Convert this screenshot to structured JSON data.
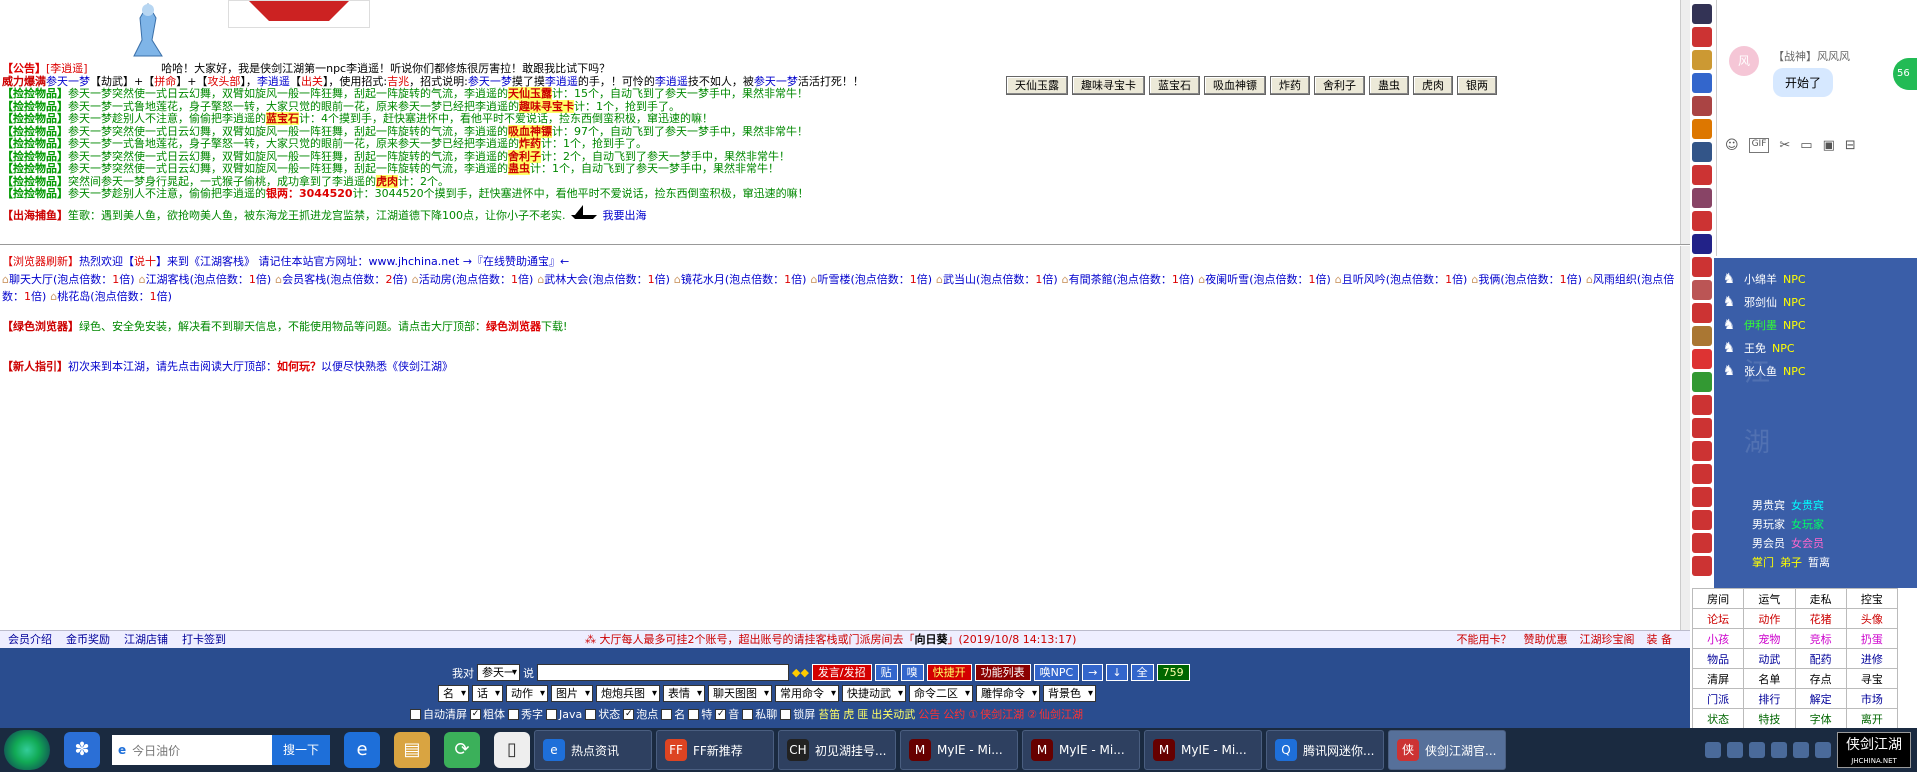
{
  "chat": {
    "announcement": {
      "tag": "【公告】",
      "npc_name": "[李逍遥]",
      "text": "哈哈！大家好，我是侠剑江湖第一npc李逍遥！听说你们都修炼很厉害拉！敢跟我比试下吗？"
    },
    "fight_line": {
      "tag": "威力爆满",
      "player": "参天一梦",
      "part1": "【劫武】+【",
      "weapon": "拼命",
      "part2": "】+【",
      "armor": "攻头部",
      "part3": "】，",
      "target": "李逍遥",
      "bracket_open": "【",
      "skill_tag": "出关",
      "bracket_close": "】，使用招式:",
      "skill": "吉兆",
      "desc_pre": "，招式说明:",
      "player2": "参天一梦",
      "desc_mid": "摸了摸",
      "target2": "李逍遥",
      "desc_mid2": "的手，！可怜的",
      "target3": "李逍遥",
      "desc_mid3": "技不如人，被",
      "player3": "参天一梦",
      "desc_end": "活活打死！！"
    },
    "pickup_lines": [
      {
        "tag": "【捡捡物品】",
        "pre": "参天一梦突然使一式日云幻舞，双臂如旋风一般一阵狂舞，刮起一阵旋转的气流，李逍遥的",
        "item": "天仙玉露",
        "post": "计：15个，自动飞到了参天一梦手中，果然非常牛！"
      },
      {
        "tag": "【捡捡物品】",
        "pre": "参天一梦一式鲁地莲花，身子擎怒一转，大家只觉的眼前一花，原来参天一梦已经把李逍遥的",
        "item": "趣味寻宝卡",
        "post": "计：1个，抢到手了。"
      },
      {
        "tag": "【捡捡物品】",
        "pre": "参天一梦趁别人不注意，偷偷把李逍遥的",
        "item": "蓝宝石",
        "post": "计：4个摸到手，赶快塞进怀中，看他平时不爱说话，捡东西倒蛮积极，窜迅速的嘛！"
      },
      {
        "tag": "【捡捡物品】",
        "pre": "参天一梦突然使一式日云幻舞，双臂如旋风一般一阵狂舞，刮起一阵旋转的气流，李逍遥的",
        "item": "吸血神镖",
        "post": "计：97个，自动飞到了参天一梦手中，果然非常牛！"
      },
      {
        "tag": "【捡捡物品】",
        "pre": "参天一梦一式鲁地莲花，身子擎怒一转，大家只觉的眼前一花，原来参天一梦已经把李逍遥的",
        "item": "炸药",
        "post": "计：1个，抢到手了。"
      },
      {
        "tag": "【捡捡物品】",
        "pre": "参天一梦突然使一式日云幻舞，双臂如旋风一般一阵狂舞，刮起一阵旋转的气流，李逍遥的",
        "item": "舍利子",
        "post": "计：2个，自动飞到了参天一梦手中，果然非常牛！"
      },
      {
        "tag": "【捡捡物品】",
        "pre": "参天一梦突然使一式日云幻舞，双臂如旋风一般一阵狂舞，刮起一阵旋转的气流，李逍遥的",
        "item": "蛊虫",
        "post": "计：1个，自动飞到了参天一梦手中，果然非常牛！"
      },
      {
        "tag": "【捡捡物品】",
        "pre": "突然间参天一梦身行晁起，一式猴子偷桃，成功拿到了李逍遥的",
        "item": "虎肉",
        "post": "计：2个。"
      },
      {
        "tag": "【捡捡物品】",
        "pre": "参天一梦趁别人不注意，偷偷把李逍遥的",
        "item": "银两：3044520",
        "post": "计：3044520个摸到手，赶快塞进怀中，看他平时不爱说话，捡东西倒蛮积极，窜迅速的嘛！"
      }
    ],
    "sea_line": {
      "tag": "【出海捕鱼】",
      "text": "笙歌：遇到美人鱼，欲抢吻美人鱼，被东海龙王抓进龙宫监禁，江湖道德下降100点，让你小子不老实.",
      "link": "我要出海"
    },
    "item_buttons": [
      "天仙玉露",
      "趣味寻宝卡",
      "蓝宝石",
      "吸血神镖",
      "炸药",
      "舍利子",
      "蛊虫",
      "虎肉",
      "银两"
    ]
  },
  "lobby": {
    "refresh_line": {
      "tag": "【浏览器刷新】",
      "pre": "热烈欢迎【",
      "name": "说十",
      "mid": "】来到《江湖客栈》 请记住本站官方网址：www.jhchina.net →『在线赞助通宝』←"
    },
    "rooms": [
      {
        "name": "聊天大厅",
        "info": "(泡点倍数：",
        "mult": "1",
        "end": "倍)"
      },
      {
        "name": "江湖客栈",
        "info": "(泡点倍数：",
        "mult": "1",
        "end": "倍)"
      },
      {
        "name": "会员客栈",
        "info": "(泡点倍数：",
        "mult": "2",
        "end": "倍)"
      },
      {
        "name": "活动房",
        "info": "(泡点倍数：",
        "mult": "1",
        "end": "倍)"
      },
      {
        "name": "武林大会",
        "info": "(泡点倍数：",
        "mult": "1",
        "end": "倍)"
      },
      {
        "name": "镜花水月",
        "info": "(泡点倍数：",
        "mult": "1",
        "end": "倍)"
      },
      {
        "name": "听雪楼",
        "info": "(泡点倍数：",
        "mult": "1",
        "end": "倍)"
      },
      {
        "name": "武当山",
        "info": "(泡点倍数：",
        "mult": "1",
        "end": "倍)"
      },
      {
        "name": "有間茶館",
        "info": "(泡点倍数：",
        "mult": "1",
        "end": "倍)"
      },
      {
        "name": "夜阑听雪",
        "info": "(泡点倍数：",
        "mult": "1",
        "end": "倍)"
      }
    ],
    "rooms_row2": [
      {
        "name": "且听风吟",
        "info": "(泡点倍数：",
        "mult": "1",
        "end": "倍)"
      },
      {
        "name": "我俩",
        "info": "(泡点倍数：",
        "mult": "1",
        "end": "倍)"
      },
      {
        "name": "风雨组织",
        "info": "(泡点倍数：",
        "mult": "1",
        "end": "倍)"
      },
      {
        "name": "桃花岛",
        "info": "(泡点倍数：",
        "mult": "1",
        "end": "倍)"
      }
    ],
    "green_browser": {
      "tag": "【绿色浏览器】",
      "text": "绿色、安全免安装，解决看不到聊天信息，不能使用物品等问题。请点击大厅顶部：",
      "link": "绿色浏览器",
      "end": "下载!"
    },
    "newbie": {
      "tag": "【新人指引】",
      "text": "初次来到本江湖，请先点击阅读大厅顶部：",
      "link": "如何玩？",
      "end": "以便尽快熟悉《侠剑江湖》"
    }
  },
  "status_bar": {
    "left_links": [
      "会员介绍",
      "金币奖励",
      "江湖店铺",
      "打卡签到"
    ],
    "notice_pre": "⁂ 大厅每人最多可挂2个账号，超出账号的请挂客栈或门派房间去「",
    "notice_room": "向日葵",
    "notice_post": "」(2019/10/8 14:13:17)",
    "right_links": [
      "不能用卡？",
      "赞助优惠",
      "江湖珍宝阁",
      "装 备"
    ]
  },
  "controls": {
    "say_prefix": "我对",
    "say_target": "参天一",
    "say_suffix": "说",
    "send_button": "发言/发招",
    "paste_button": "贴",
    "clear_button": "嗅",
    "quick_open": "快捷开",
    "function_list": "功能列表",
    "wake_npc": "唤NPC",
    "arrow_right": "→",
    "arrow_down": "↓",
    "all": "全",
    "counter": "759",
    "selects": [
      "名",
      "话",
      "动作",
      "图片",
      "炮炮兵图",
      "表情",
      "聊天图图",
      "常用命令",
      "快捷动武",
      "命令二区",
      "雕悍命令",
      "背景色"
    ],
    "checkboxes": [
      {
        "label": "自动清屏",
        "checked": false
      },
      {
        "label": "粗体",
        "checked": true
      },
      {
        "label": "秀字",
        "checked": false
      },
      {
        "label": "Java",
        "checked": false
      },
      {
        "label": "状态",
        "checked": false
      },
      {
        "label": "泡点",
        "checked": true
      },
      {
        "label": "名",
        "checked": false
      },
      {
        "label": "特",
        "checked": false
      },
      {
        "label": "音",
        "checked": true
      },
      {
        "label": "私聊",
        "checked": false
      },
      {
        "label": "锁屏",
        "checked": false
      }
    ],
    "extra_links": [
      "苔笛",
      "虎",
      "匪",
      "出关动武",
      "公告",
      "公约"
    ],
    "jianghu_1": "侠剑江湖",
    "jianghu_2": "仙剑江湖"
  },
  "sidebar": {
    "npcs": [
      {
        "name": "小绵羊",
        "type": "NPC"
      },
      {
        "name": "邪剑仙",
        "type": "NPC"
      },
      {
        "name": "伊利墨",
        "type": "NPC"
      },
      {
        "name": "王免",
        "type": "NPC"
      },
      {
        "name": "张人鱼",
        "type": "NPC"
      }
    ],
    "legend": [
      [
        "男贵宾",
        "女贵宾"
      ],
      [
        "男玩家",
        "女玩家"
      ],
      [
        "男会员",
        "女会员"
      ],
      [
        "掌门",
        "弟子",
        "暂离"
      ]
    ],
    "commands": [
      [
        "房间",
        "运气",
        "走私",
        "控宝"
      ],
      [
        "论坛",
        "动作",
        "花猪",
        "头像"
      ],
      [
        "小孩",
        "宠物",
        "竞标",
        "扔蛋"
      ],
      [
        "物品",
        "动武",
        "配药",
        "进修"
      ],
      [
        "清屏",
        "名单",
        "存点",
        "寻宝"
      ],
      [
        "门派",
        "排行",
        "解定",
        "市场"
      ],
      [
        "状态",
        "特技",
        "字体",
        "离开"
      ]
    ]
  },
  "qq_popup": {
    "sender": "【战神】风风风",
    "message": "开始了",
    "avatar_text": "风",
    "badge": "56"
  },
  "taskbar": {
    "search_placeholder": "今日油价",
    "search_button": "搜一下",
    "tasks": [
      {
        "label": "热点资讯",
        "icon": "e"
      },
      {
        "label": "FF新推荐",
        "icon": "FF"
      },
      {
        "label": "初见湖挂号...",
        "icon": "CH"
      },
      {
        "label": "MyIE - Mi...",
        "icon": "M"
      },
      {
        "label": "MyIE - Mi...",
        "icon": "M"
      },
      {
        "label": "MyIE - Mi...",
        "icon": "M"
      },
      {
        "label": "腾讯网迷你...",
        "icon": "Q"
      },
      {
        "label": "侠剑江湖官...",
        "icon": "侠"
      }
    ],
    "brand": "侠剑江湖",
    "brand_sub": "JHCHINA.NET"
  }
}
